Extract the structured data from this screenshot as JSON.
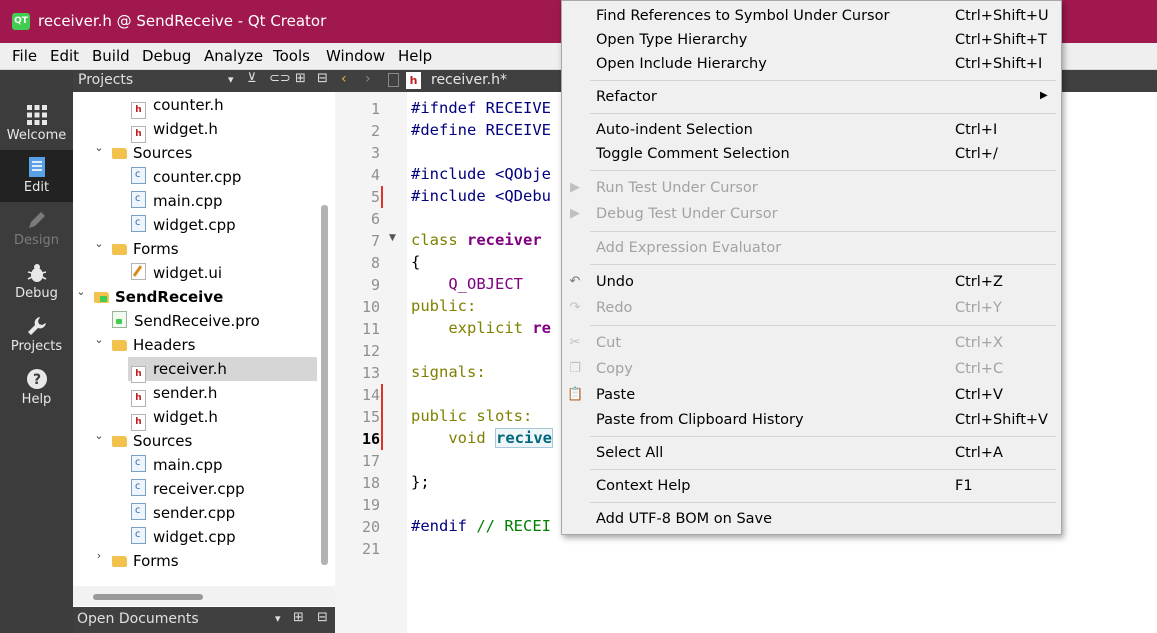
{
  "window": {
    "title": "receiver.h @ SendReceive - Qt Creator",
    "app_icon": "QT"
  },
  "menubar": [
    "File",
    "Edit",
    "Build",
    "Debug",
    "Analyze",
    "Tools",
    "Window",
    "Help"
  ],
  "modes": [
    {
      "label": "Welcome",
      "icon": "grid-icon"
    },
    {
      "label": "Edit",
      "icon": "document-icon"
    },
    {
      "label": "Design",
      "icon": "pencil-icon"
    },
    {
      "label": "Debug",
      "icon": "bug-icon"
    },
    {
      "label": "Projects",
      "icon": "wrench-icon"
    },
    {
      "label": "Help",
      "icon": "question-icon"
    }
  ],
  "projects_pane": {
    "title": "Projects"
  },
  "tree": [
    {
      "label": "counter.h",
      "type": "h"
    },
    {
      "label": "widget.h",
      "type": "h"
    },
    {
      "label": "Sources",
      "type": "folder"
    },
    {
      "label": "counter.cpp",
      "type": "cpp"
    },
    {
      "label": "main.cpp",
      "type": "cpp"
    },
    {
      "label": "widget.cpp",
      "type": "cpp"
    },
    {
      "label": "Forms",
      "type": "folder"
    },
    {
      "label": "widget.ui",
      "type": "ui"
    },
    {
      "label": "SendReceive",
      "type": "project"
    },
    {
      "label": "SendReceive.pro",
      "type": "pro"
    },
    {
      "label": "Headers",
      "type": "folder"
    },
    {
      "label": "receiver.h",
      "type": "h",
      "selected": true
    },
    {
      "label": "sender.h",
      "type": "h"
    },
    {
      "label": "widget.h",
      "type": "h"
    },
    {
      "label": "Sources",
      "type": "folder"
    },
    {
      "label": "main.cpp",
      "type": "cpp"
    },
    {
      "label": "receiver.cpp",
      "type": "cpp"
    },
    {
      "label": "sender.cpp",
      "type": "cpp"
    },
    {
      "label": "widget.cpp",
      "type": "cpp"
    },
    {
      "label": "Forms",
      "type": "folder",
      "collapsed": true
    }
  ],
  "open_documents": {
    "title": "Open Documents"
  },
  "editor": {
    "tab_label": "receiver.h*",
    "line_numbers": [
      "1",
      "2",
      "3",
      "4",
      "5",
      "6",
      "7",
      "8",
      "9",
      "10",
      "11",
      "12",
      "13",
      "14",
      "15",
      "16",
      "17",
      "18",
      "19",
      "20",
      "21"
    ],
    "current_line": "16",
    "code": {
      "l1": "#ifndef RECEIVE",
      "l2": "#define RECEIVE",
      "l4": "#include <QObje",
      "l5": "#include <QDebu",
      "l7a": "class ",
      "l7b": "receiver",
      "l8": "{",
      "l9": "    Q_OBJECT",
      "l10": "public:",
      "l11a": "    explicit ",
      "l11b": "re",
      "l13": "signals:",
      "l15": "public slots:",
      "l16a": "    void ",
      "l16b": "recive",
      "l18": "};",
      "l20a": "#endif ",
      "l20b": "// RECEI"
    }
  },
  "context_menu": {
    "items": [
      {
        "label": "Find References to Symbol Under Cursor",
        "shortcut": "Ctrl+Shift+U"
      },
      {
        "label": "Open Type Hierarchy",
        "shortcut": "Ctrl+Shift+T"
      },
      {
        "label": "Open Include Hierarchy",
        "shortcut": "Ctrl+Shift+I"
      },
      {
        "label": "Refactor",
        "shortcut": ""
      },
      {
        "label": "Auto-indent Selection",
        "shortcut": "Ctrl+I"
      },
      {
        "label": "Toggle Comment Selection",
        "shortcut": "Ctrl+/"
      },
      {
        "label": "Run Test Under Cursor",
        "shortcut": ""
      },
      {
        "label": "Debug Test Under Cursor",
        "shortcut": ""
      },
      {
        "label": "Add Expression Evaluator",
        "shortcut": ""
      },
      {
        "label": "Undo",
        "shortcut": "Ctrl+Z"
      },
      {
        "label": "Redo",
        "shortcut": "Ctrl+Y"
      },
      {
        "label": "Cut",
        "shortcut": "Ctrl+X"
      },
      {
        "label": "Copy",
        "shortcut": "Ctrl+C"
      },
      {
        "label": "Paste",
        "shortcut": "Ctrl+V"
      },
      {
        "label": "Paste from Clipboard History",
        "shortcut": "Ctrl+Shift+V"
      },
      {
        "label": "Select All",
        "shortcut": "Ctrl+A"
      },
      {
        "label": "Context Help",
        "shortcut": "F1"
      },
      {
        "label": "Add UTF-8 BOM on Save",
        "shortcut": ""
      }
    ]
  },
  "colors": {
    "titlebar": "#a0184e",
    "sidebar": "#3c3c3c",
    "accent_qt": "#41cd52"
  }
}
